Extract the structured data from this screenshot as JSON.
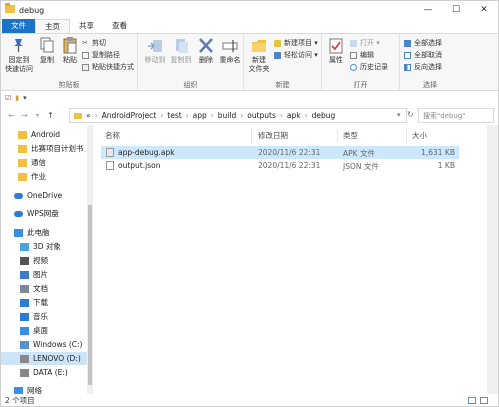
{
  "window": {
    "title": "debug"
  },
  "ribbon_tabs": [
    "文件",
    "主页",
    "共享",
    "查看"
  ],
  "ribbon": {
    "clipboard": {
      "pin": "固定到\n快速访问",
      "copy": "复制",
      "paste": "粘贴",
      "cut": "剪切",
      "copy_path": "复制路径",
      "paste_shortcut": "粘贴快捷方式",
      "label": "剪贴板"
    },
    "organize": {
      "move_to": "移动到",
      "copy_to": "复制到",
      "delete": "删除",
      "rename": "重命名",
      "label": "组织"
    },
    "new": {
      "new_folder": "新建\n文件夹",
      "new_item": "新建项目 ▾",
      "easy_access": "轻松访问 ▾",
      "label": "新建"
    },
    "open": {
      "properties": "属性",
      "open": "打开 ▾",
      "edit": "编辑",
      "history": "历史记录",
      "label": "打开"
    },
    "select": {
      "select_all": "全部选择",
      "select_none": "全部取消",
      "invert": "反向选择",
      "label": "选择"
    }
  },
  "address": {
    "segments": [
      "«",
      "AndroidProject",
      "test",
      "app",
      "build",
      "outputs",
      "apk",
      "debug"
    ],
    "search_placeholder": "搜索\"debug\""
  },
  "nav": [
    {
      "label": "Android",
      "color": "#f1c040"
    },
    {
      "label": "比赛项目计划书",
      "color": "#f1c040"
    },
    {
      "label": "通信",
      "color": "#f1c040"
    },
    {
      "label": "作业",
      "color": "#f1c040"
    },
    {
      "label": "OneDrive",
      "color": "#2b7cd3"
    },
    {
      "label": "WPS网盘",
      "color": "#2b7cd3"
    },
    {
      "label": "此电脑",
      "color": "#3a8ee6"
    },
    {
      "label": "3D 对象",
      "color": "#4aa3df"
    },
    {
      "label": "视频",
      "color": "#555555"
    },
    {
      "label": "图片",
      "color": "#3d7cc9"
    },
    {
      "label": "文档",
      "color": "#7a8a99"
    },
    {
      "label": "下载",
      "color": "#2b7cd3"
    },
    {
      "label": "音乐",
      "color": "#2b7cd3"
    },
    {
      "label": "桌面",
      "color": "#3a8ee6"
    },
    {
      "label": "Windows (C:)",
      "color": "#5a8fcf"
    },
    {
      "label": "LENOVO (D:)",
      "color": "#888888"
    },
    {
      "label": "DATA (E:)",
      "color": "#888888"
    },
    {
      "label": "网络",
      "color": "#3a8ee6"
    }
  ],
  "columns": {
    "name": "名称",
    "date": "修改日期",
    "type": "类型",
    "size": "大小"
  },
  "files": [
    {
      "name": "app-debug.apk",
      "date": "2020/11/6 22:31",
      "type": "APK 文件",
      "size": "1,631 KB"
    },
    {
      "name": "output.json",
      "date": "2020/11/6 22:31",
      "type": "JSON 文件",
      "size": "1 KB"
    }
  ],
  "status": {
    "items": "2 个项目"
  }
}
